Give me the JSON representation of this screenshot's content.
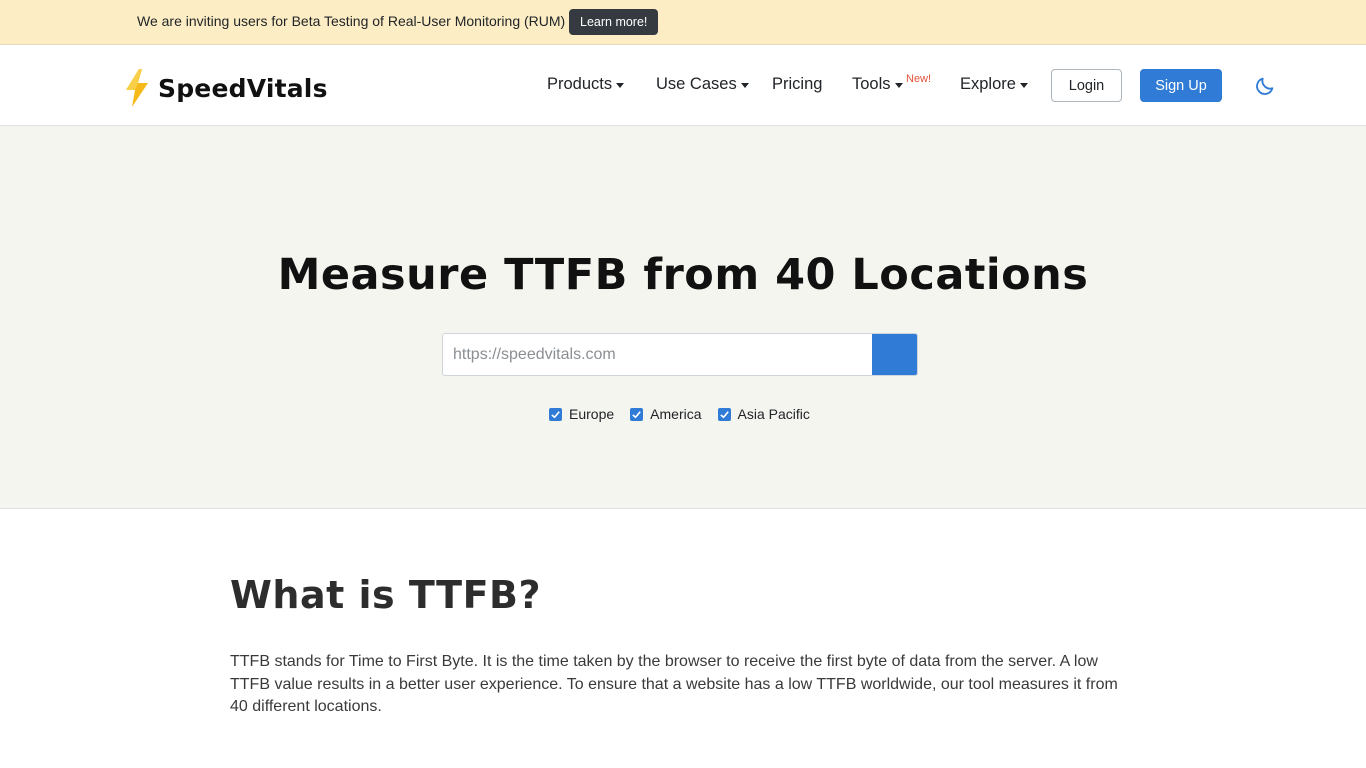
{
  "announcement": {
    "text": "We are inviting users for Beta Testing of Real-User Monitoring (RUM)",
    "button_label": "Learn more!"
  },
  "brand": {
    "name": "SpeedVitals",
    "logo_icon": "lightning-bolt-icon",
    "accent_color": "#f5b91a"
  },
  "nav": {
    "products": "Products",
    "use_cases": "Use Cases",
    "pricing": "Pricing",
    "tools": "Tools",
    "tools_badge": "New!",
    "explore": "Explore",
    "login": "Login",
    "signup": "Sign Up",
    "theme_toggle_icon": "moon-icon"
  },
  "hero": {
    "title": "Measure TTFB from 40 Locations",
    "search_placeholder": "https://speedvitals.com",
    "search_value": "",
    "regions": [
      {
        "label": "Europe",
        "checked": true
      },
      {
        "label": "America",
        "checked": true
      },
      {
        "label": "Asia Pacific",
        "checked": true
      }
    ]
  },
  "content": {
    "title": "What is TTFB?",
    "paragraph": "TTFB stands for Time to First Byte. It is the time taken by the browser to receive the first byte of data from the server. A low TTFB value results in a better user experience. To ensure that a website has a low TTFB worldwide, our tool measures it from 40 different locations."
  },
  "colors": {
    "primary": "#2f7bd6",
    "announcement_bg": "#fdedc4",
    "hero_bg": "#f5f5f0",
    "badge": "#e0533a"
  }
}
